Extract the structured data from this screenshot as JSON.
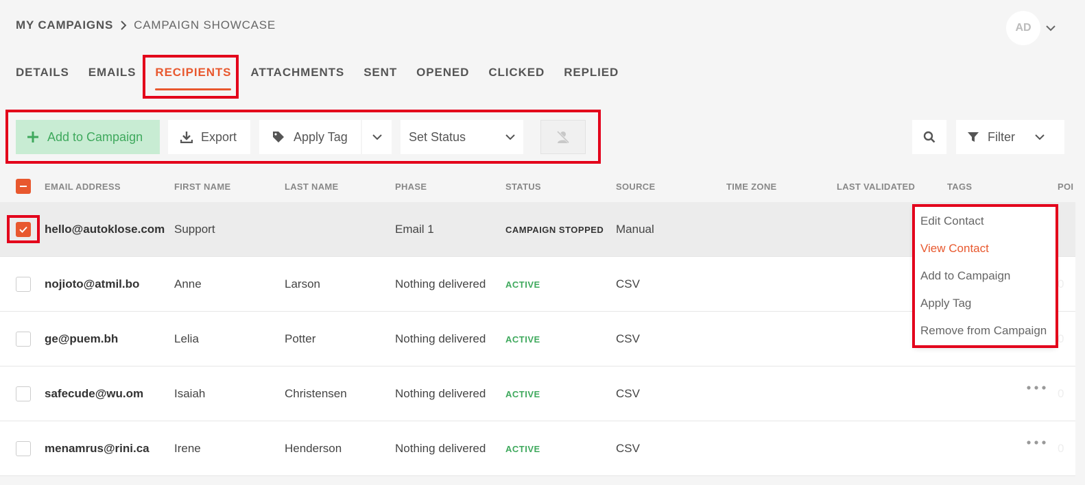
{
  "breadcrumb": {
    "root": "MY CAMPAIGNS",
    "current": "CAMPAIGN SHOWCASE"
  },
  "user": {
    "initials": "AD"
  },
  "tabs": [
    {
      "label": "DETAILS"
    },
    {
      "label": "EMAILS"
    },
    {
      "label": "RECIPIENTS",
      "active": true
    },
    {
      "label": "ATTACHMENTS"
    },
    {
      "label": "SENT"
    },
    {
      "label": "OPENED"
    },
    {
      "label": "CLICKED"
    },
    {
      "label": "REPLIED"
    }
  ],
  "toolbar": {
    "add_label": "Add to Campaign",
    "export_label": "Export",
    "apply_tag_label": "Apply Tag",
    "set_status_label": "Set Status",
    "filter_label": "Filter"
  },
  "table": {
    "headers": {
      "email": "EMAIL ADDRESS",
      "first": "FIRST NAME",
      "last": "LAST NAME",
      "phase": "PHASE",
      "status": "STATUS",
      "source": "SOURCE",
      "timezone": "TIME ZONE",
      "validated": "LAST VALIDATED",
      "tags": "TAGS",
      "extra": "POI"
    },
    "rows": [
      {
        "email": "hello@autoklose.com",
        "first": "Support",
        "last": "",
        "phase": "Email 1",
        "status": "CAMPAIGN STOPPED",
        "source": "Manual",
        "checked": true
      },
      {
        "email": "nojioto@atmil.bo",
        "first": "Anne",
        "last": "Larson",
        "phase": "Nothing delivered",
        "status": "ACTIVE",
        "source": "CSV",
        "checked": false
      },
      {
        "email": "ge@puem.bh",
        "first": "Lelia",
        "last": "Potter",
        "phase": "Nothing delivered",
        "status": "ACTIVE",
        "source": "CSV",
        "checked": false
      },
      {
        "email": "safecude@wu.om",
        "first": "Isaiah",
        "last": "Christensen",
        "phase": "Nothing delivered",
        "status": "ACTIVE",
        "source": "CSV",
        "checked": false
      },
      {
        "email": "menamrus@rini.ca",
        "first": "Irene",
        "last": "Henderson",
        "phase": "Nothing delivered",
        "status": "ACTIVE",
        "source": "CSV",
        "checked": false
      }
    ],
    "extra_value": "0"
  },
  "context_menu": {
    "items": [
      "Edit Contact",
      "View Contact",
      "Add to Campaign",
      "Apply Tag",
      "Remove from Campaign"
    ],
    "hovered": "View Contact"
  },
  "colors": {
    "accent": "#e8582e",
    "success": "#3fa95d",
    "highlight": "#e3001b"
  }
}
